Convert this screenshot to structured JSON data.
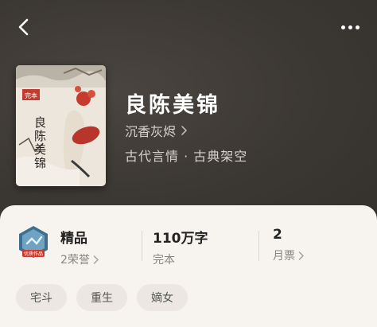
{
  "book": {
    "title": "良陈美锦",
    "author": "沉香灰烬",
    "genre": "古代言情 · 古典架空"
  },
  "cover": {
    "title_text": "良陈美锦",
    "badge_text": "完本"
  },
  "stats": {
    "quality": {
      "main": "精品",
      "sub": "2荣誉"
    },
    "words": {
      "main": "110万字",
      "sub": "完本"
    },
    "tickets": {
      "main": "2",
      "sub": "月票"
    }
  },
  "badge_icon": {
    "label": "优质作品"
  },
  "tags": [
    "宅斗",
    "重生",
    "嫡女"
  ],
  "icons": {
    "back": "chevron-left-icon",
    "more": "more-dots-icon",
    "chevron": "chevron-right-icon"
  }
}
